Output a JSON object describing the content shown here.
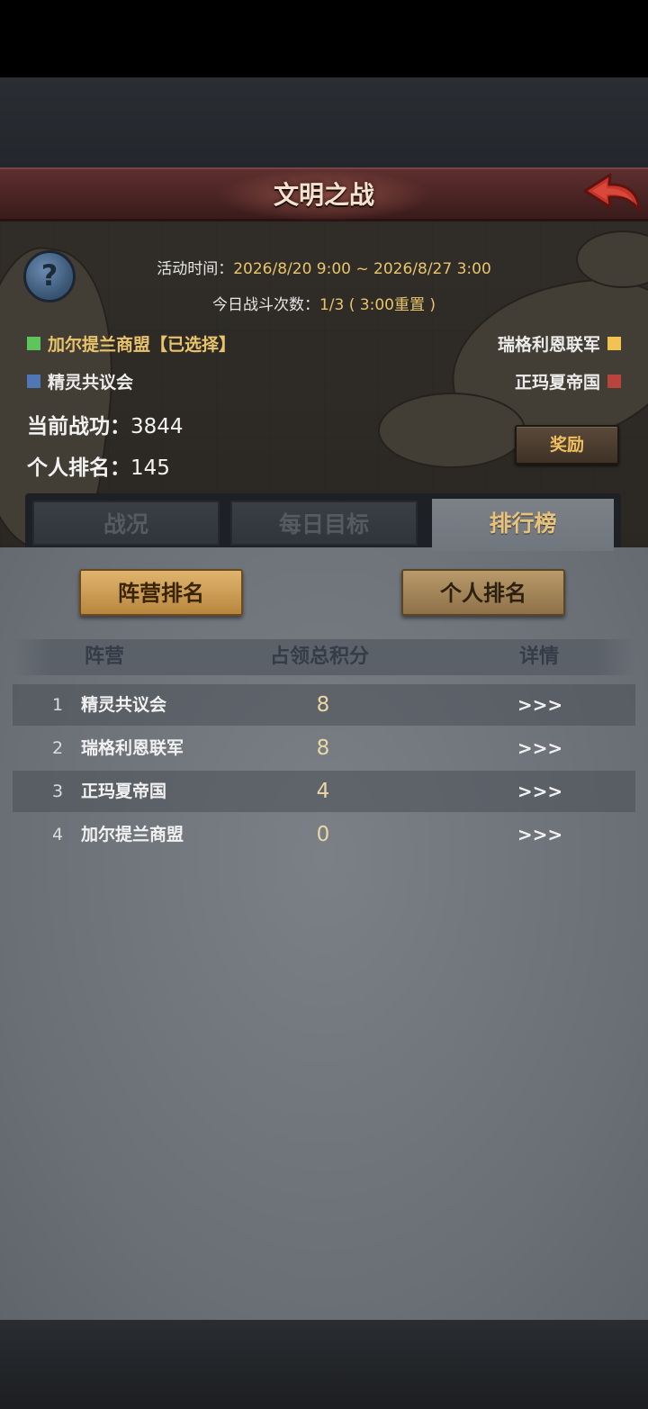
{
  "header": {
    "title": "文明之战"
  },
  "event": {
    "time_label": "活动时间：",
    "time_value": "2026/8/20 9:00 ~ 2026/8/27 3:00",
    "battles_label": "今日战斗次数：",
    "battles_value": "1/3 ( 3:00重置 )"
  },
  "factions": {
    "selected": {
      "name": "加尔提兰商盟【已选择】",
      "color": "#5ec45c"
    },
    "yellow": {
      "name": "瑞格利恩联军",
      "color": "#f2c350"
    },
    "blue": {
      "name": "精灵共议会",
      "color": "#4f76b5"
    },
    "red": {
      "name": "正玛夏帝国",
      "color": "#b8443b"
    }
  },
  "stats": {
    "merit_label": "当前战功：",
    "merit_value": "3844",
    "rank_label": "个人排名：",
    "rank_value": "145"
  },
  "reward_button": "奖励",
  "tabs": [
    {
      "label": "战况",
      "active": false
    },
    {
      "label": "每日目标",
      "active": false
    },
    {
      "label": "排行榜",
      "active": true
    }
  ],
  "sub_tabs": {
    "faction_rank": "阵营排名",
    "personal_rank": "个人排名"
  },
  "table": {
    "headers": {
      "faction": "阵营",
      "score": "占领总积分",
      "detail": "详情"
    },
    "rows": [
      {
        "rank": "1",
        "name": "精灵共议会",
        "score": "8",
        "detail": ">>>"
      },
      {
        "rank": "2",
        "name": "瑞格利恩联军",
        "score": "8",
        "detail": ">>>"
      },
      {
        "rank": "3",
        "name": "正玛夏帝国",
        "score": "4",
        "detail": ">>>"
      },
      {
        "rank": "4",
        "name": "加尔提兰商盟",
        "score": "0",
        "detail": ">>>"
      }
    ]
  },
  "icons": {
    "help": "question-icon",
    "back": "back-arrow-icon"
  }
}
